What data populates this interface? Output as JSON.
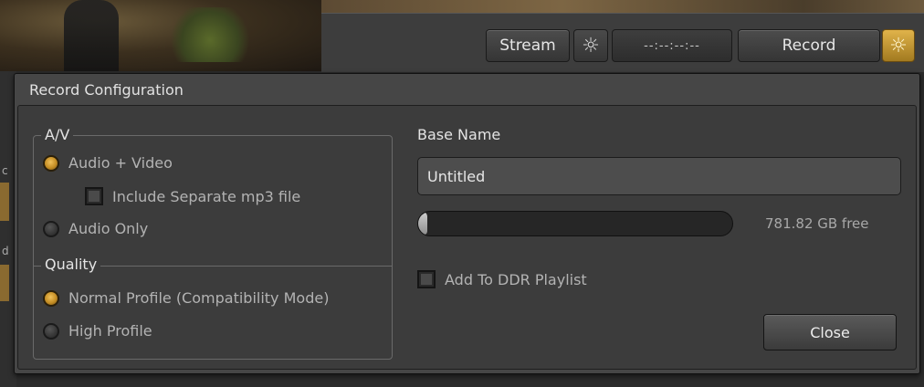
{
  "toolbar": {
    "stream_label": "Stream",
    "stream_gear_icon": "gear-icon",
    "timecode": "--:--:--:--",
    "record_label": "Record",
    "record_gear_icon": "gear-icon",
    "accent_color": "#d9a93e"
  },
  "edge": {
    "text1": "c",
    "text2": "d"
  },
  "dialog": {
    "title": "Record Configuration",
    "av_group": {
      "legend": "A/V",
      "options": [
        {
          "label": "Audio + Video",
          "selected": true
        },
        {
          "label": "Audio Only",
          "selected": false
        }
      ],
      "include_mp3": {
        "label": "Include Separate mp3 file",
        "checked": false
      }
    },
    "quality_group": {
      "legend": "Quality",
      "options": [
        {
          "label": "Normal Profile (Compatibility Mode)",
          "selected": true
        },
        {
          "label": "High Profile",
          "selected": false
        }
      ]
    },
    "base_name": {
      "label": "Base Name",
      "value": "Untitled"
    },
    "storage": {
      "used_fraction": 0.03,
      "free_text": "781.82 GB free"
    },
    "add_to_ddr": {
      "label": "Add To DDR Playlist",
      "checked": false
    },
    "close_label": "Close"
  }
}
